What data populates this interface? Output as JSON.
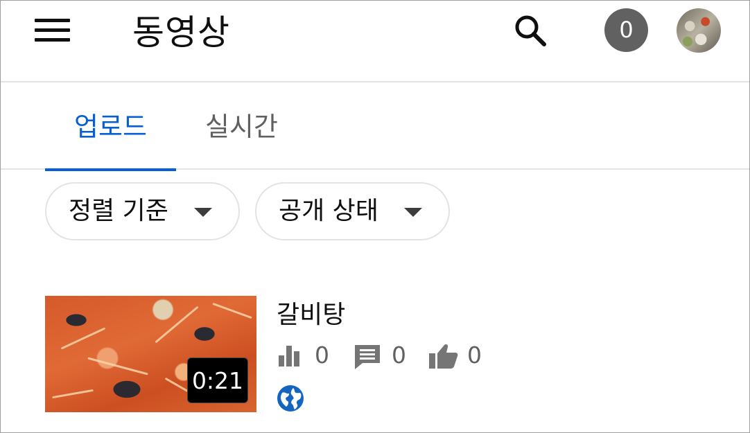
{
  "header": {
    "title": "동영상",
    "notification_count": "0",
    "icons": {
      "menu": "menu-icon",
      "search": "search-icon",
      "avatar": "avatar"
    }
  },
  "tabs": [
    {
      "label": "업로드",
      "active": true
    },
    {
      "label": "실시간",
      "active": false
    }
  ],
  "filters": {
    "sort_label": "정렬 기준",
    "visibility_label": "공개 상태"
  },
  "videos": [
    {
      "title": "갈비탕",
      "duration": "0:21",
      "views": "0",
      "comments": "0",
      "likes": "0",
      "visibility_icon": "public-globe-icon"
    }
  ],
  "colors": {
    "accent": "#065fd4",
    "text": "#0f0f0f",
    "secondary_text": "#606060",
    "divider": "#e3e3e3",
    "badge_bg": "#616161"
  }
}
